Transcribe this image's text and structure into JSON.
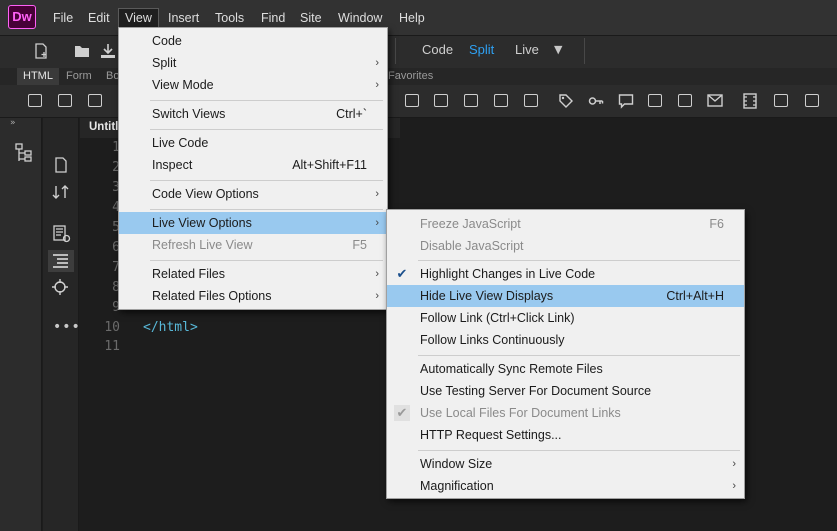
{
  "app": {
    "logo": "Dw"
  },
  "menubar": {
    "items": [
      "File",
      "Edit",
      "View",
      "Insert",
      "Tools",
      "Find",
      "Site",
      "Window",
      "Help"
    ],
    "active": "View"
  },
  "view_switch": {
    "code": "Code",
    "split": "Split",
    "live": "Live",
    "active": "Split",
    "accent": "#2ea0f2"
  },
  "insert_tabs": [
    "HTML",
    "Form",
    "Bo",
    "Favorites"
  ],
  "document": {
    "tab_title": "Untitl",
    "line_numbers": [
      "1",
      "2",
      "3",
      "4",
      "5",
      "6",
      "7",
      "8",
      "9",
      "10",
      "11"
    ],
    "partial_digits": [
      "1",
      "2",
      "3",
      "4",
      "5",
      "6",
      "7",
      "8",
      "9"
    ],
    "line10_code": "</html>"
  },
  "view_menu": {
    "items": [
      {
        "label": "Code",
        "shortcut": "",
        "submenu": false
      },
      {
        "label": "Split",
        "shortcut": "",
        "submenu": true
      },
      {
        "label": "View Mode",
        "shortcut": "",
        "submenu": true
      },
      {
        "label": "Switch Views",
        "shortcut": "Ctrl+`",
        "submenu": false
      },
      {
        "label": "Live Code",
        "shortcut": "",
        "submenu": false
      },
      {
        "label": "Inspect",
        "shortcut": "Alt+Shift+F11",
        "submenu": false
      },
      {
        "label": "Code View Options",
        "shortcut": "",
        "submenu": true
      },
      {
        "label": "Live View Options",
        "shortcut": "",
        "submenu": true,
        "highlighted": true
      },
      {
        "label": "Refresh Live View",
        "shortcut": "F5",
        "submenu": false,
        "disabled": true
      },
      {
        "label": "Related Files",
        "shortcut": "",
        "submenu": true
      },
      {
        "label": "Related Files Options",
        "shortcut": "",
        "submenu": true
      }
    ]
  },
  "live_view_submenu": {
    "items": [
      {
        "label": "Freeze JavaScript",
        "shortcut": "F6",
        "disabled": true
      },
      {
        "label": "Disable JavaScript",
        "shortcut": "",
        "disabled": true
      },
      {
        "label": "Highlight Changes in Live Code",
        "shortcut": "",
        "checked": true
      },
      {
        "label": "Hide Live View Displays",
        "shortcut": "Ctrl+Alt+H",
        "highlighted": true
      },
      {
        "label": "Follow Link (Ctrl+Click Link)",
        "shortcut": ""
      },
      {
        "label": "Follow Links Continuously",
        "shortcut": ""
      },
      {
        "label": "Automatically Sync Remote Files",
        "shortcut": ""
      },
      {
        "label": "Use Testing Server For Document Source",
        "shortcut": ""
      },
      {
        "label": "Use Local Files For Document Links",
        "shortcut": "",
        "disabled": true,
        "checked": true
      },
      {
        "label": "HTTP Request Settings...",
        "shortcut": ""
      },
      {
        "label": "Window Size",
        "shortcut": "",
        "submenu": true
      },
      {
        "label": "Magnification",
        "shortcut": "",
        "submenu": true
      }
    ]
  },
  "colors": {
    "highlight": "#99c9ef",
    "editor_bg": "#1d1d1d",
    "code_text": "#58b8d8"
  }
}
